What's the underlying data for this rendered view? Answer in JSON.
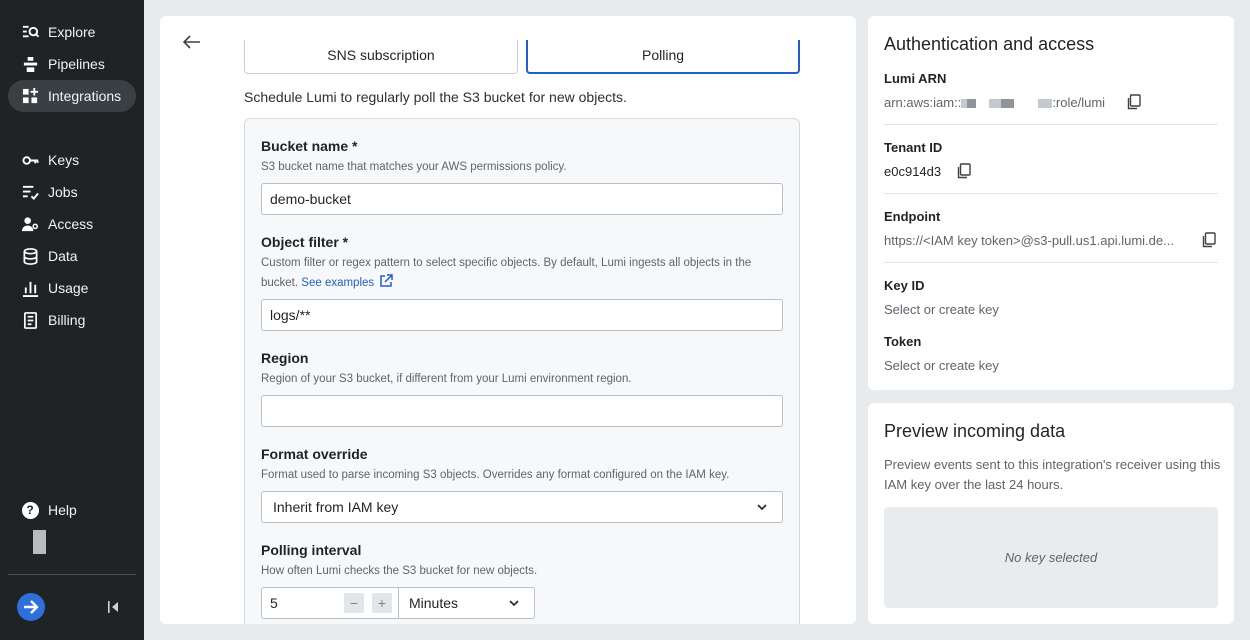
{
  "sidebar": {
    "items": [
      {
        "label": "Explore",
        "icon": "explore-icon"
      },
      {
        "label": "Pipelines",
        "icon": "pipelines-icon"
      },
      {
        "label": "Integrations",
        "icon": "integrations-icon",
        "active": true
      },
      {
        "label": "Keys",
        "icon": "key-icon"
      },
      {
        "label": "Jobs",
        "icon": "jobs-icon"
      },
      {
        "label": "Access",
        "icon": "access-icon"
      },
      {
        "label": "Data",
        "icon": "database-icon"
      },
      {
        "label": "Usage",
        "icon": "bar-chart-icon"
      },
      {
        "label": "Billing",
        "icon": "receipt-icon"
      }
    ],
    "help_label": "Help"
  },
  "tabs": {
    "sns": "SNS subscription",
    "polling": "Polling",
    "selected": "Polling"
  },
  "form": {
    "intro": "Schedule Lumi to regularly poll the S3 bucket for new objects.",
    "bucket_name": {
      "label": "Bucket name *",
      "help": "S3 bucket name that matches your AWS permissions policy.",
      "value": "demo-bucket"
    },
    "object_filter": {
      "label": "Object filter *",
      "help": "Custom filter or regex pattern to select specific objects. By default, Lumi ingests all objects in the bucket.",
      "link": "See examples",
      "value": "logs/**"
    },
    "region": {
      "label": "Region",
      "help": "Region of your S3 bucket, if different from your Lumi environment region.",
      "value": ""
    },
    "format_override": {
      "label": "Format override",
      "help": "Format used to parse incoming S3 objects. Overrides any format configured on the IAM key.",
      "value": "Inherit from IAM key"
    },
    "polling_interval": {
      "label": "Polling interval",
      "help": "How often Lumi checks the S3 bucket for new objects.",
      "value": "5",
      "decrement": "−",
      "increment": "+",
      "unit": "Minutes"
    }
  },
  "auth": {
    "title": "Authentication and access",
    "arn_label": "Lumi ARN",
    "arn_prefix": "arn:aws:iam::",
    "arn_suffix": ":role/lumi",
    "tenant_label": "Tenant ID",
    "tenant_value": "e0c914d3",
    "endpoint_label": "Endpoint",
    "endpoint_value": "https://<IAM key token>@s3-pull.us1.api.lumi.de...",
    "key_id_label": "Key ID",
    "key_id_value": "Select or create key",
    "token_label": "Token",
    "token_value": "Select or create key"
  },
  "preview": {
    "title": "Preview incoming data",
    "description": "Preview events sent to this integration's receiver using this IAM key over the last 24 hours.",
    "empty": "No key selected"
  },
  "colors": {
    "sidebar_bg": "#1f2326",
    "accent": "#1f5fcf",
    "page_bg": "#e8ebee"
  }
}
